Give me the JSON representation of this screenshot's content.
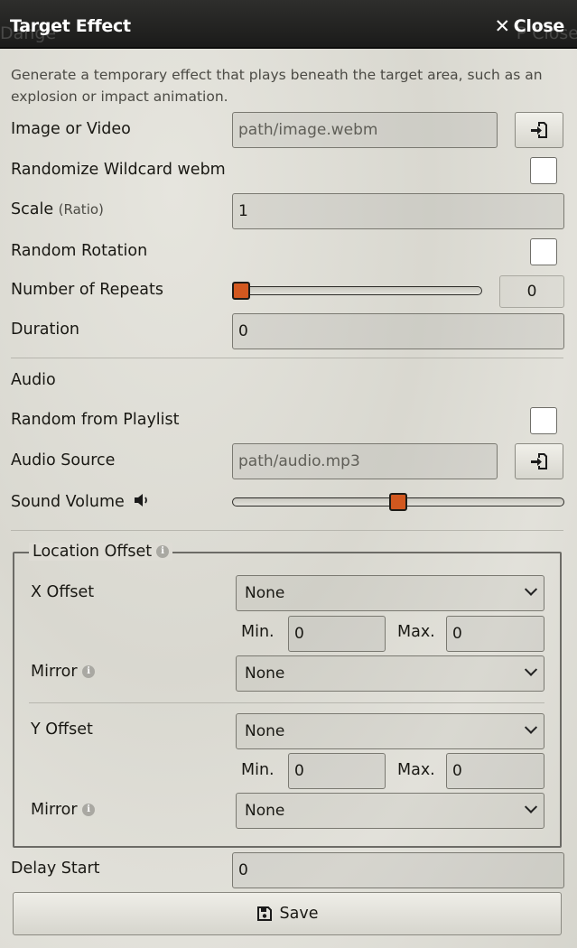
{
  "window": {
    "title": "Target Effect",
    "close_label": "Close",
    "ghost_left": "Dange",
    "ghost_right": "P Close"
  },
  "notes": "Generate a temporary effect that plays beneath the target area, such as an explosion or impact animation.",
  "fields": {
    "image_label": "Image or Video",
    "image_placeholder": "path/image.webm",
    "randomize_label": "Randomize Wildcard webm",
    "scale_label": "Scale",
    "scale_hint": "(Ratio)",
    "scale_value": "1",
    "rotation_label": "Random Rotation",
    "repeats_label": "Number of Repeats",
    "repeats_value": "0",
    "repeats_fraction": 0,
    "duration_label": "Duration",
    "duration_value": "0",
    "audio_label": "Audio",
    "playlist_label": "Random from Playlist",
    "audio_source_label": "Audio Source",
    "audio_placeholder": "path/audio.mp3",
    "volume_label": "Sound Volume",
    "volume_fraction": 0.5,
    "delay_label": "Delay Start",
    "delay_value": "0"
  },
  "location": {
    "legend": "Location Offset",
    "x_offset_label": "X Offset",
    "x_offset_value": "None",
    "x_min_label": "Min.",
    "x_min_value": "0",
    "x_max_label": "Max.",
    "x_max_value": "0",
    "x_mirror_label": "Mirror",
    "x_mirror_value": "None",
    "y_offset_label": "Y Offset",
    "y_offset_value": "None",
    "y_min_label": "Min.",
    "y_min_value": "0",
    "y_max_label": "Max.",
    "y_max_value": "0",
    "y_mirror_label": "Mirror",
    "y_mirror_value": "None"
  },
  "save_label": "Save",
  "colors": {
    "accent_thumb": "#d2581f",
    "header_bg": "#1b1b1a"
  }
}
